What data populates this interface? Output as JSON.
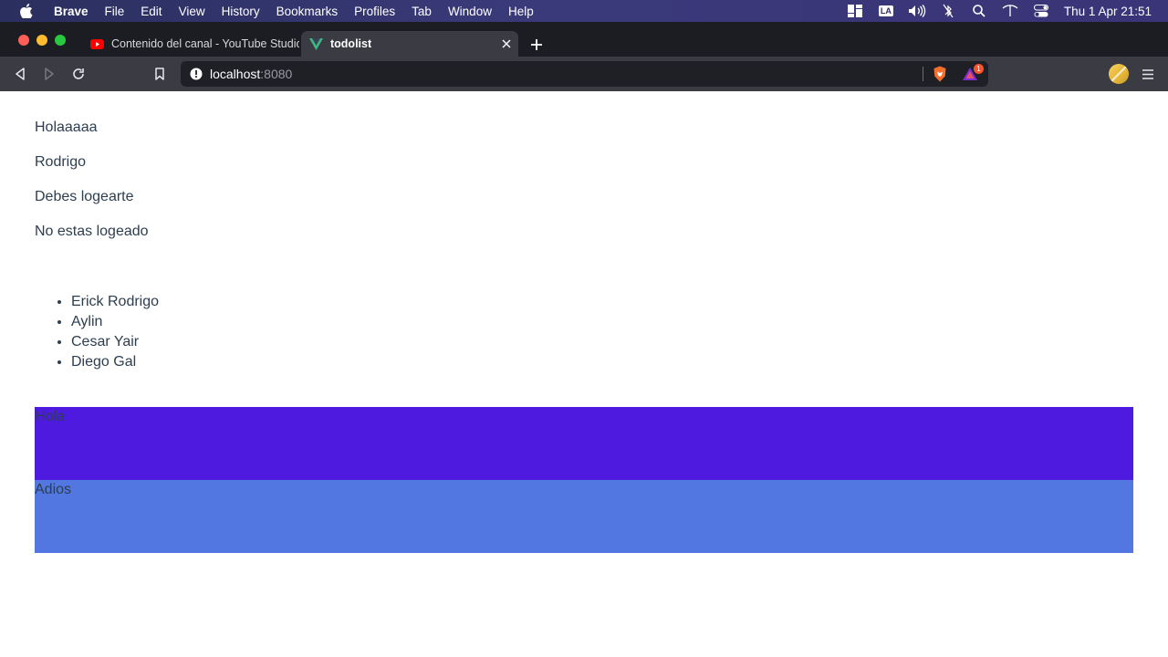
{
  "menubar": {
    "app_name": "Brave",
    "items": [
      "File",
      "Edit",
      "View",
      "History",
      "Bookmarks",
      "Profiles",
      "Tab",
      "Window",
      "Help"
    ],
    "clock": "Thu 1 Apr  21:51",
    "input_source": "LA"
  },
  "tabs": [
    {
      "title": "Contenido del canal - YouTube Studio",
      "favicon": "youtube-icon",
      "active": false
    },
    {
      "title": "todolist",
      "favicon": "vue-icon",
      "active": true
    }
  ],
  "address_bar": {
    "host": "localhost",
    "port": ":8080",
    "rewards_badge": "1"
  },
  "page": {
    "lines": [
      "Holaaaaa",
      "Rodrigo",
      "Debes logearte",
      "No estas logeado"
    ],
    "names": [
      "Erick Rodrigo",
      "Aylin",
      "Cesar Yair",
      "Diego Gal"
    ],
    "blocks": [
      {
        "label": "Hola",
        "color": "#4f1ae0"
      },
      {
        "label": "Adios",
        "color": "#5277e0"
      }
    ]
  },
  "colors": {
    "text": "#2c3e50",
    "tab_active": "#3b3b44",
    "tabstrip": "#1c1c23"
  }
}
